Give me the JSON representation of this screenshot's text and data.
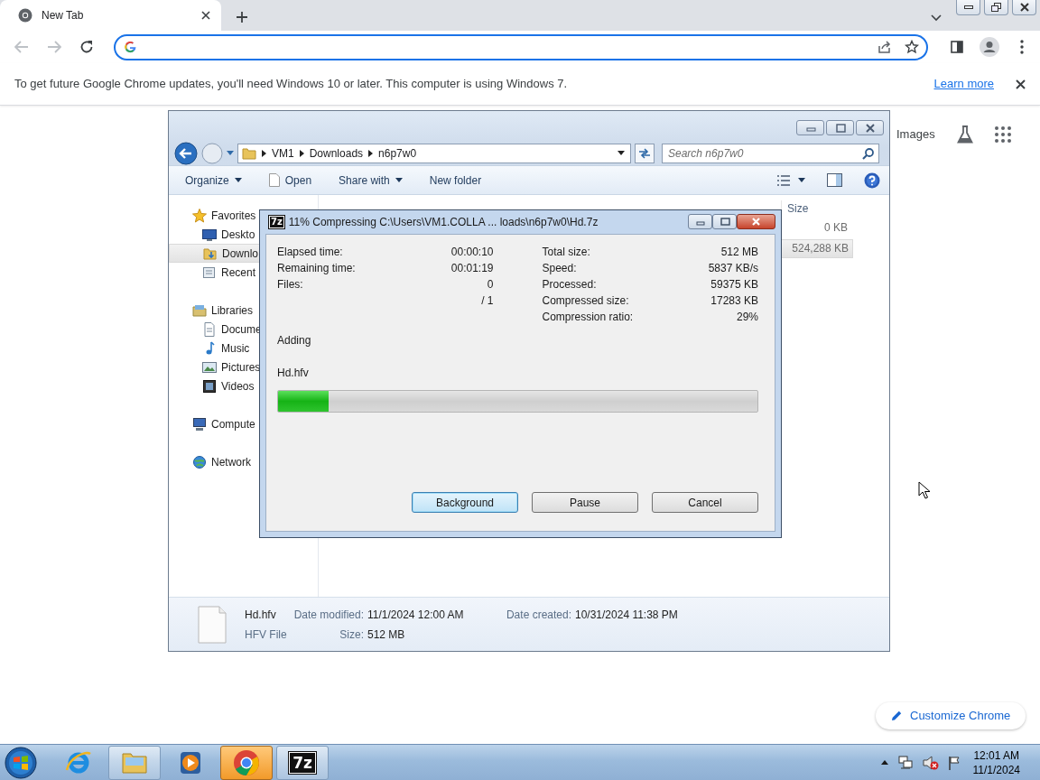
{
  "browser": {
    "tab": {
      "title": "New Tab",
      "selected": true
    },
    "infobar": {
      "message": "To get future Google Chrome updates, you'll need Windows 10 or later. This computer is using Windows 7.",
      "link": "Learn more"
    }
  },
  "new_tab_page": {
    "links": [
      "Images"
    ],
    "customize_button": "Customize Chrome"
  },
  "explorer": {
    "breadcrumb": [
      "VM1",
      "Downloads",
      "n6p7w0"
    ],
    "search": {
      "placeholder": "Search n6p7w0"
    },
    "toolbar": [
      {
        "label": "Organize",
        "kind": "dropdown"
      },
      {
        "label": "Open",
        "kind": "file"
      },
      {
        "label": "Share with",
        "kind": "dropdown"
      },
      {
        "label": "New folder",
        "kind": "plain"
      }
    ],
    "navigation": [
      {
        "label": "Favorites",
        "kind": "favorites",
        "selected": false,
        "children": [
          {
            "label": "Deskto",
            "kind": "desktop",
            "selected": false
          },
          {
            "label": "Downlo",
            "kind": "downloads",
            "selected": true
          },
          {
            "label": "Recent",
            "kind": "recent",
            "selected": false
          }
        ]
      },
      {
        "label": "Libraries",
        "kind": "libraries",
        "selected": false,
        "children": [
          {
            "label": "Docume",
            "kind": "documents",
            "selected": false
          },
          {
            "label": "Music",
            "kind": "music",
            "selected": false
          },
          {
            "label": "Pictures",
            "kind": "pictures",
            "selected": false
          },
          {
            "label": "Videos",
            "kind": "videos",
            "selected": false
          }
        ]
      },
      {
        "label": "Compute",
        "kind": "computer",
        "selected": false
      },
      {
        "label": "Network",
        "kind": "network",
        "selected": false
      }
    ],
    "columns": [
      "Size"
    ],
    "rows": [
      {
        "size": "0 KB",
        "selected": false
      },
      {
        "size": "524,288 KB",
        "selected": true
      }
    ],
    "details": {
      "name": "Hd.hfv",
      "type": "HFV File",
      "fields": [
        {
          "label": "Date modified:",
          "value": "11/1/2024 12:00 AM"
        },
        {
          "label": "Date created:",
          "value": "10/31/2024 11:38 PM"
        },
        {
          "label": "Size:",
          "value": "512 MB"
        }
      ]
    }
  },
  "dialog": {
    "icon_text": "7z",
    "title": "11% Compressing C:\\Users\\VM1.COLLA ... loads\\n6p7w0\\Hd.7z",
    "stats_left": [
      {
        "label": "Elapsed time:",
        "value": "00:00:10"
      },
      {
        "label": "Remaining time:",
        "value": "00:01:19"
      },
      {
        "label": "Files:",
        "value": "0"
      },
      {
        "value": "/ 1"
      }
    ],
    "stats_right": [
      {
        "label": "Total size:",
        "value": "512 MB"
      },
      {
        "label": "Speed:",
        "value": "5837 KB/s"
      },
      {
        "label": "Processed:",
        "value": "59375 KB"
      },
      {
        "label": "Compressed size:",
        "value": "17283 KB"
      },
      {
        "label": "Compression ratio:",
        "value": "29%"
      }
    ],
    "status": "Adding",
    "file": "Hd.hfv",
    "progress": {
      "level": 0.105
    },
    "buttons": [
      {
        "label": "Background",
        "default": true
      },
      {
        "label": "Pause",
        "default": false
      },
      {
        "label": "Cancel",
        "default": false
      }
    ]
  },
  "taskbar": {
    "apps": [
      {
        "kind": "internet-explorer",
        "open": false,
        "selected": false
      },
      {
        "kind": "file-explorer",
        "open": true,
        "selected": false
      },
      {
        "kind": "media-player",
        "open": false,
        "selected": false
      },
      {
        "kind": "chrome",
        "open": true,
        "selected": true
      },
      {
        "kind": "seven-zip",
        "label": "7z",
        "open": true,
        "selected": false
      }
    ],
    "clock": {
      "time": "12:01 AM",
      "date": "11/1/2024"
    }
  }
}
